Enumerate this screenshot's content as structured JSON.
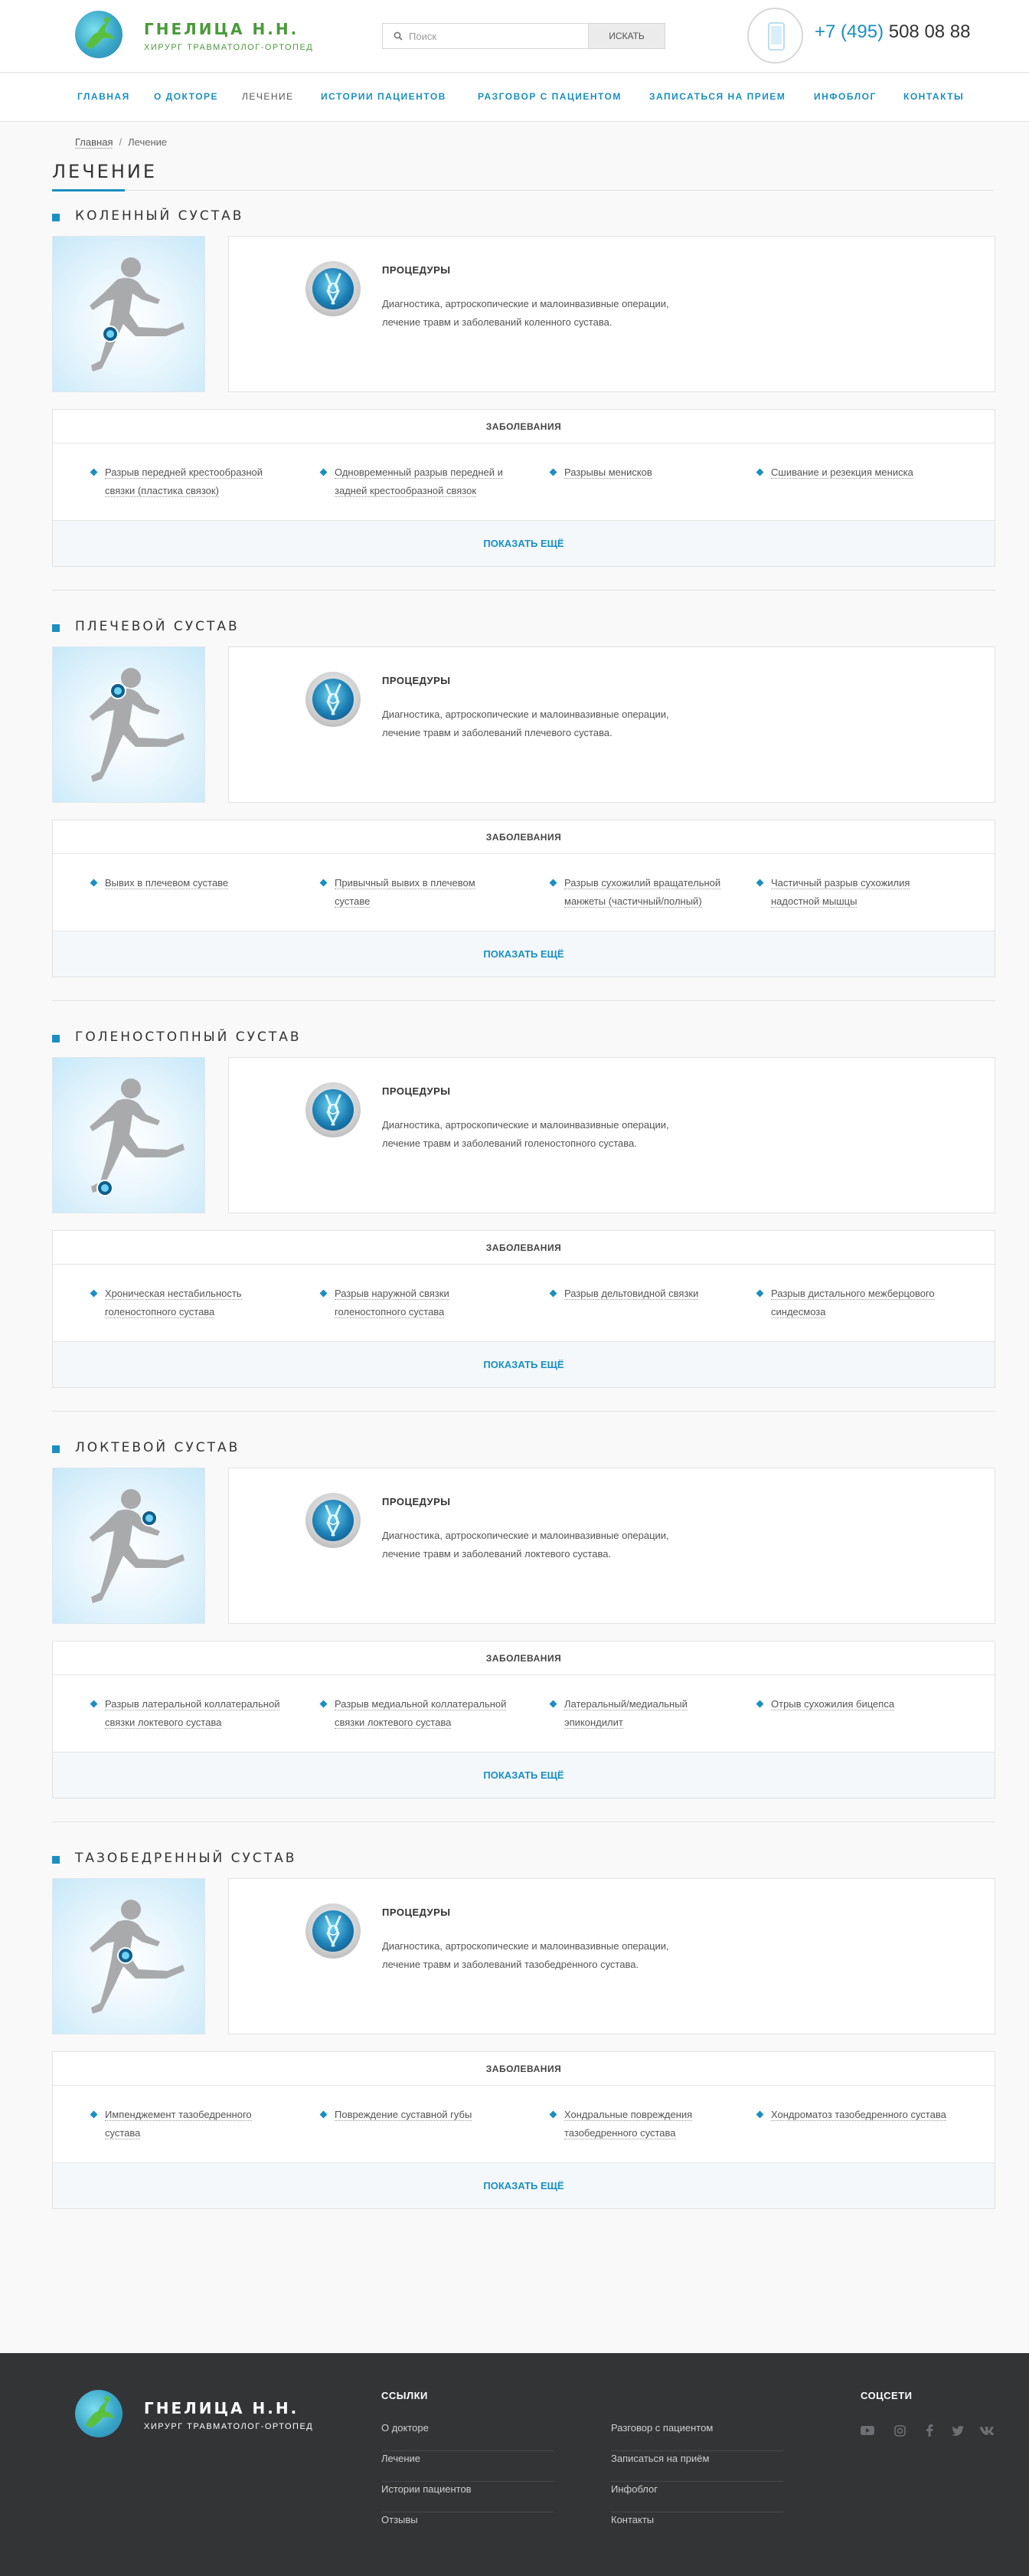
{
  "header": {
    "logo_title": "ГНЕЛИЦА Н.Н.",
    "logo_subtitle": "ХИРУРГ ТРАВМАТОЛОГ-ОРТОПЕД",
    "search_placeholder": "Поиск",
    "search_button": "ИСКАТЬ",
    "phone_code": "+7 (495)",
    "phone_number": "508 08 88"
  },
  "nav": [
    "ГЛАВНАЯ",
    "О ДОКТОРЕ",
    "ЛЕЧЕНИЕ",
    "ИСТОРИИ ПАЦИЕНТОВ",
    "РАЗГОВОР С ПАЦИЕНТОМ",
    "ЗАПИСАТЬСЯ НА ПРИЕМ",
    "ИНФОБЛОГ",
    "КОНТАКТЫ"
  ],
  "nav_active": "ЛЕЧЕНИЕ",
  "breadcrumb": {
    "home": "Главная",
    "separator": "/",
    "current": "Лечение"
  },
  "page_title": "ЛЕЧЕНИЕ",
  "sections": [
    {
      "title": "КОЛЕННЫЙ СУСТАВ",
      "joint": "knee",
      "procedures_title": "ПРОЦЕДУРЫ",
      "procedures_desc": "Диагностика, артроскопические и малоинвазивные операции, лечение травм и заболеваний коленного сустава.",
      "diseases_title": "ЗАБОЛЕВАНИЯ",
      "diseases": [
        "Разрыв передней крестообразной связки (пластика связок)",
        "Одновременный разрыв передней и задней крестообразной связок",
        "Разрывы менисков",
        "Сшивание и резекция мениска"
      ],
      "show_more": "ПОКАЗАТЬ ЕЩЁ"
    },
    {
      "title": "ПЛЕЧЕВОЙ СУСТАВ",
      "joint": "shoulder",
      "procedures_title": "ПРОЦЕДУРЫ",
      "procedures_desc": "Диагностика, артроскопические и малоинвазивные операции, лечение травм и заболеваний плечевого сустава.",
      "diseases_title": "ЗАБОЛЕВАНИЯ",
      "diseases": [
        "Вывих в плечевом суставе",
        "Привычный вывих в плечевом суставе",
        "Разрыв сухожилий вращательной манжеты (частичный/полный)",
        "Частичный разрыв сухожилия надостной мышцы"
      ],
      "show_more": "ПОКАЗАТЬ ЕЩЁ"
    },
    {
      "title": "ГОЛЕНОСТОПНЫЙ СУСТАВ",
      "joint": "ankle",
      "procedures_title": "ПРОЦЕДУРЫ",
      "procedures_desc": "Диагностика, артроскопические и малоинвазивные операции, лечение травм и заболеваний голеностопного сустава.",
      "diseases_title": "ЗАБОЛЕВАНИЯ",
      "diseases": [
        "Хроническая нестабильность голеностопного сустава",
        "Разрыв наружной связки голеностопного сустава",
        "Разрыв дельтовидной связки",
        "Разрыв дистального межберцового синдесмоза"
      ],
      "show_more": "ПОКАЗАТЬ ЕЩЁ"
    },
    {
      "title": "ЛОКТЕВОЙ СУСТАВ",
      "joint": "elbow",
      "procedures_title": "ПРОЦЕДУРЫ",
      "procedures_desc": "Диагностика, артроскопические и малоинвазивные операции, лечение травм и заболеваний локтевого сустава.",
      "diseases_title": "ЗАБОЛЕВАНИЯ",
      "diseases": [
        "Разрыв латеральной коллатеральной связки локтевого сустава",
        "Разрыв медиальной коллатеральной связки локтевого сустава",
        "Латеральный/медиальный эпикондилит",
        "Отрыв сухожилия бицепса"
      ],
      "show_more": "ПОКАЗАТЬ ЕЩЁ"
    },
    {
      "title": "ТАЗОБЕДРЕННЫЙ СУСТАВ",
      "joint": "hip",
      "procedures_title": "ПРОЦЕДУРЫ",
      "procedures_desc": "Диагностика, артроскопические и малоинвазивные операции, лечение травм и заболеваний тазобедренного сустава.",
      "diseases_title": "ЗАБОЛЕВАНИЯ",
      "diseases": [
        "Импенджемент тазобедренного сустава",
        "Повреждение суставной губы",
        "Хондральные повреждения тазобедренного сустава",
        "Хондроматоз тазобедренного сустава"
      ],
      "show_more": "ПОКАЗАТЬ ЕЩЁ"
    }
  ],
  "footer": {
    "logo_title": "ГНЕЛИЦА Н.Н.",
    "logo_subtitle": "ХИРУРГ ТРАВМАТОЛОГ-ОРТОПЕД",
    "links_title": "ССЫЛКИ",
    "links_col1": [
      "О докторе",
      "Лечение",
      "Истории пациентов",
      "Отзывы"
    ],
    "links_col2": [
      "Разговор с пациентом",
      "Записаться на приём",
      "Инфоблог",
      "Контакты"
    ],
    "social_title": "СОЦСЕТИ",
    "social": [
      "youtube-icon",
      "instagram-icon",
      "facebook-icon",
      "twitter-icon",
      "vk-icon"
    ]
  },
  "colors": {
    "accent": "#1a8fc1",
    "brand_green": "#4a9a3a",
    "footer_bg": "#333436"
  }
}
